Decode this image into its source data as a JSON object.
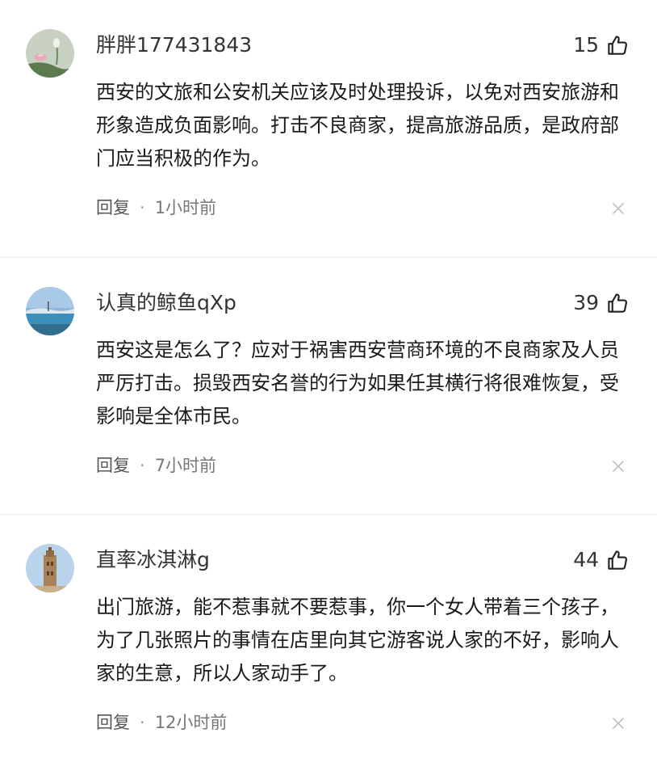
{
  "comments": [
    {
      "username": "胖胖177431843",
      "likes": "15",
      "text": "西安的文旅和公安机关应该及时处理投诉，以免对西安旅游和形象造成负面影响。打击不良商家，提高旅游品质，是政府部门应当积极的作为。",
      "reply_label": "回复",
      "separator": "·",
      "time": "1小时前",
      "avatar_icon": "lotus-avatar"
    },
    {
      "username": "认真的鲸鱼qXp",
      "likes": "39",
      "text": "西安这是怎么了？应对于祸害西安营商环境的不良商家及人员严厉打击。损毁西安名誉的行为如果任其横行将很难恢复，受影响是全体市民。",
      "reply_label": "回复",
      "separator": "·",
      "time": "7小时前",
      "avatar_icon": "lake-avatar"
    },
    {
      "username": "直率冰淇淋g",
      "likes": "44",
      "text": "出门旅游，能不惹事就不要惹事，你一个女人带着三个孩子，为了几张照片的事情在店里向其它游客说人家的不好，影响人家的生意，所以人家动手了。",
      "reply_label": "回复",
      "separator": "·",
      "time": "12小时前",
      "avatar_icon": "tower-avatar"
    }
  ],
  "icons": {
    "like": "thumbs-up-icon",
    "close": "close-icon"
  },
  "colors": {
    "text": "#1a1a1a",
    "meta": "#555555",
    "close": "#c4c4c4"
  }
}
